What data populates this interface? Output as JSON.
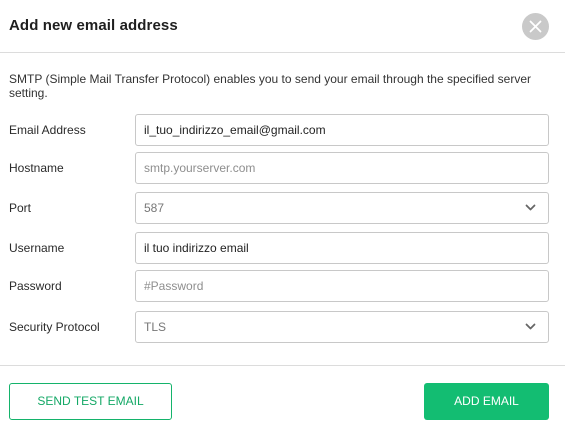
{
  "dialog": {
    "title": "Add new email address",
    "description": "SMTP (Simple Mail Transfer Protocol) enables you to send your email through the specified server setting."
  },
  "form": {
    "email": {
      "label": "Email Address",
      "value": "il_tuo_indirizzo_email@gmail.com"
    },
    "hostname": {
      "label": "Hostname",
      "placeholder": "smtp.yourserver.com"
    },
    "port": {
      "label": "Port",
      "value": "587"
    },
    "username": {
      "label": "Username",
      "value": "il tuo indirizzo email"
    },
    "password": {
      "label": "Password",
      "placeholder": "#Password"
    },
    "security": {
      "label": "Security Protocol",
      "value": "TLS"
    }
  },
  "buttons": {
    "send_test": "SEND TEST EMAIL",
    "add_email": "ADD EMAIL"
  },
  "icons": {
    "close": "close-icon",
    "dropdown": "chevron-down-icon"
  },
  "colors": {
    "accent": "#13bd72",
    "close_bg": "#c9c9c9"
  }
}
